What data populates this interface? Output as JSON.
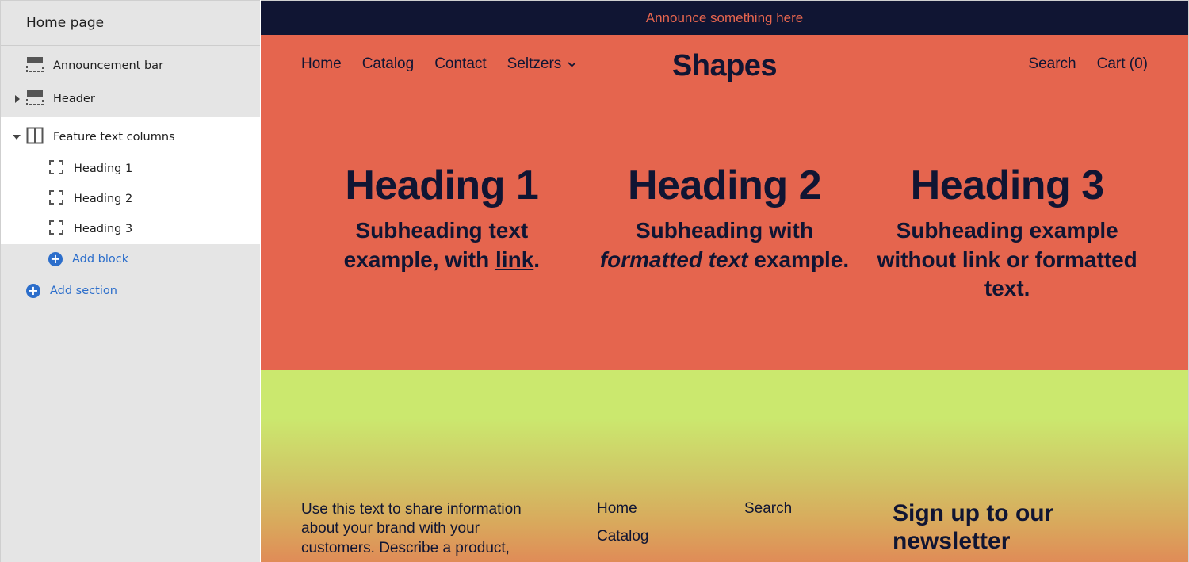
{
  "sidebar": {
    "title": "Home page",
    "items": [
      {
        "label": "Announcement bar",
        "icon": "section-layout-icon"
      },
      {
        "label": "Header",
        "icon": "section-layout-icon",
        "collapsed": true
      },
      {
        "label": "Feature text columns",
        "icon": "columns-icon",
        "expanded": true,
        "blocks": [
          {
            "label": "Heading 1"
          },
          {
            "label": "Heading 2"
          },
          {
            "label": "Heading 3"
          }
        ],
        "add_block_label": "Add block"
      }
    ],
    "add_section_label": "Add section"
  },
  "preview": {
    "announcement": "Announce something here",
    "header": {
      "nav": [
        "Home",
        "Catalog",
        "Contact",
        "Seltzers"
      ],
      "logo": "Shapes",
      "search_label": "Search",
      "cart_label": "Cart (0)"
    },
    "features": [
      {
        "heading": "Heading 1",
        "sub_before": "Subheading text example, with ",
        "sub_link": "link",
        "sub_after": "."
      },
      {
        "heading": "Heading 2",
        "sub_before": "Subheading with ",
        "sub_em": "formatted text",
        "sub_after": " example."
      },
      {
        "heading": "Heading 3",
        "sub_text": "Subheading example without link or formatted text."
      }
    ],
    "footer": {
      "text": "Use this text to share information about your brand with your customers. Describe a product,",
      "links_col1": [
        "Home",
        "Catalog"
      ],
      "links_col2": [
        "Search"
      ],
      "newsletter_heading": "Sign up to our newsletter"
    }
  },
  "colors": {
    "navy": "#101533",
    "coral": "#e5654e",
    "lime": "#cbe86e",
    "link_blue": "#2c6ecb"
  }
}
